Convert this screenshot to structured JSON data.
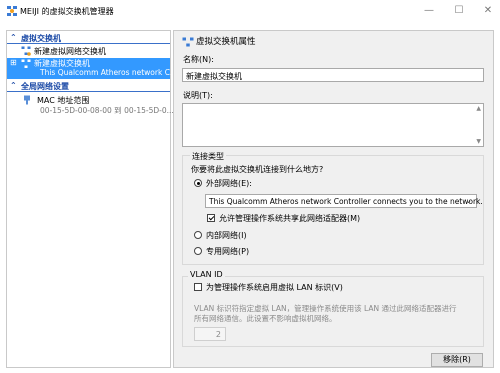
{
  "window": {
    "title": "MEIJI 的虚拟交换机管理器",
    "minimize": "—",
    "maximize": "☐",
    "close": "✕"
  },
  "sidebar": {
    "section_switch": {
      "chevron": "⌃",
      "label": "虚拟交换机"
    },
    "new_network_switch": "新建虚拟网络交换机",
    "selected_switch": {
      "name": "新建虚拟交换机",
      "sub": "This Qualcomm Atheros network C..."
    },
    "section_global": {
      "chevron": "⌃",
      "label": "全局网络设置"
    },
    "mac_range": {
      "name": "MAC 地址范围",
      "sub": "00-15-5D-00-08-00 到 00-15-5D-0..."
    }
  },
  "properties": {
    "header": "虚拟交换机属性",
    "name_label": "名称(N):",
    "name_value": "新建虚拟交换机",
    "notes_label": "说明(T):",
    "notes_value": "",
    "conn_group_title": "连接类型",
    "conn_question": "你要将此虚拟交换机连接到什么地方?",
    "external_label": "外部网络(E):",
    "adapter_value": "This Qualcomm Atheros network Controller connects you to the network.",
    "allow_share_label": "允许管理操作系统共享此网络适配器(M)",
    "internal_label": "内部网络(I)",
    "private_label": "专用网络(P)",
    "vlan_group_title": "VLAN ID",
    "vlan_enable_label": "为管理操作系统启用虚拟 LAN 标识(V)",
    "vlan_desc_line1": "VLAN 标识符指定虚拟 LAN，管理操作系统使用该 LAN 通过此网络适配器进行",
    "vlan_desc_line2": "所有网络通信。此设置不影响虚拟机网络。",
    "vlan_value": "2",
    "remove_button": "移除(R)"
  }
}
